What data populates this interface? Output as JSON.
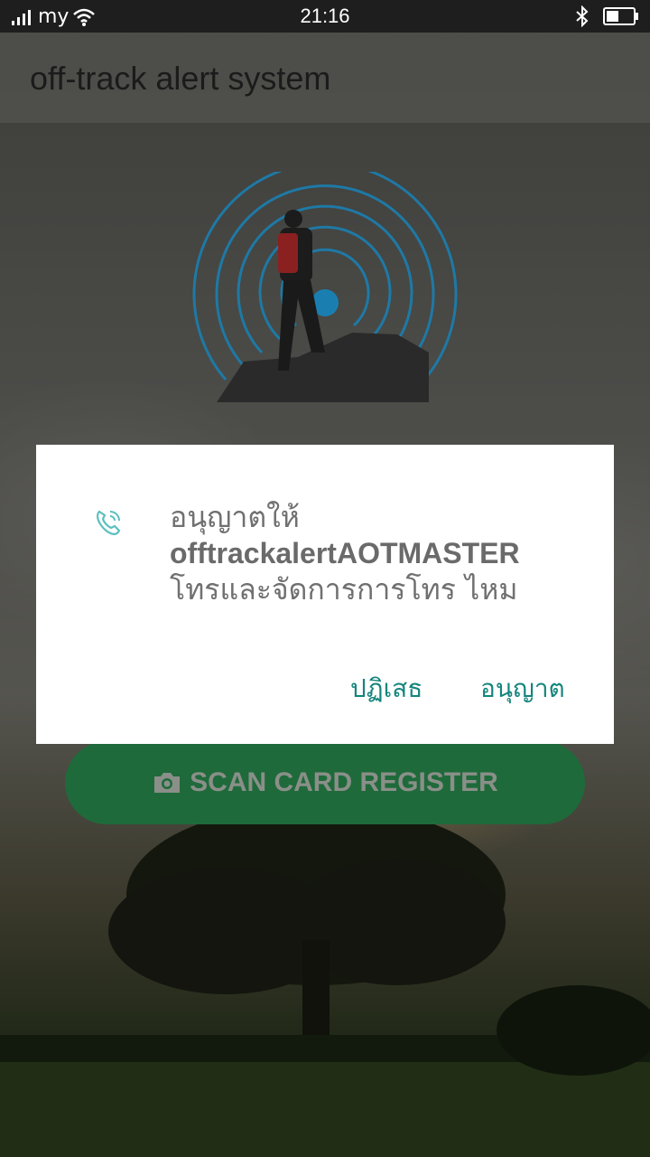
{
  "status_bar": {
    "carrier": "my",
    "time": "21:16",
    "icons": [
      "signal-icon",
      "wifi-icon",
      "bluetooth-icon",
      "battery-icon"
    ]
  },
  "app_bar": {
    "title": "off-track alert system"
  },
  "main": {
    "scan_button_label": "SCAN CARD REGISTER",
    "scan_button_icon": "camera-icon"
  },
  "dialog": {
    "icon": "phone-icon",
    "message_line1": "อนุญาตให้",
    "message_app_name": "offtrackalertAOTMASTER",
    "message_line3": "โทรและจัดการการโทร ไหม",
    "deny_label": "ปฏิเสธ",
    "allow_label": "อนุญาต",
    "accent_color": "#14857c"
  },
  "colors": {
    "scan_button": "#1f6a3a",
    "logo_rings": "#1a7fb0"
  }
}
